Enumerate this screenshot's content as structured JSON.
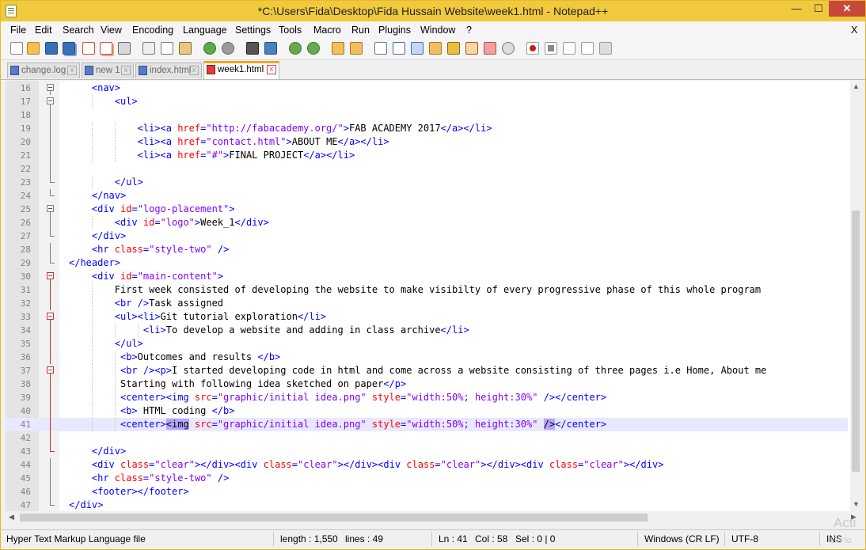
{
  "window": {
    "title": "*C:\\Users\\Fida\\Desktop\\Fida Hussain Website\\week1.html - Notepad++",
    "minimize": "—",
    "maximize": "☐",
    "close": "✕"
  },
  "menu": [
    "File",
    "Edit",
    "Search",
    "View",
    "Encoding",
    "Language",
    "Settings",
    "Tools",
    "Macro",
    "Run",
    "Plugins",
    "Window",
    "?"
  ],
  "menu_close": "X",
  "toolbar_icons": [
    "new-file-icon",
    "open-file-icon",
    "save-icon",
    "save-all-icon",
    "close-icon",
    "close-all-icon",
    "print-icon",
    "cut-icon",
    "copy-icon",
    "paste-icon",
    "undo-icon",
    "redo-icon",
    "find-icon",
    "replace-icon",
    "zoom-in-icon",
    "zoom-out-icon",
    "sync-vertical-icon",
    "sync-horizontal-icon",
    "word-wrap-icon",
    "show-all-chars-icon",
    "indent-guide-icon",
    "user-language-icon",
    "doc-map-icon",
    "function-list-icon",
    "folder-workspace-icon",
    "monitoring-icon",
    "record-macro-icon",
    "stop-record-icon",
    "play-macro-icon",
    "run-macro-multiple-icon",
    "save-macro-icon"
  ],
  "tabs": [
    {
      "label": "change.log",
      "active": false
    },
    {
      "label": "new 1",
      "active": false
    },
    {
      "label": "index.html",
      "active": false
    },
    {
      "label": "week1.html",
      "active": true
    }
  ],
  "tab_close": "x",
  "colors": {
    "tag": "#0000ff",
    "attr": "#ff0000",
    "string": "#8000ff",
    "titlebar": "#f0c93d",
    "highlight": "#b7a4ff"
  },
  "lines": [
    {
      "n": "16",
      "indent": 4,
      "fold": "box",
      "tokens": [
        [
          "tg",
          "<nav>"
        ]
      ]
    },
    {
      "n": "17",
      "indent": 8,
      "fold": "box",
      "tokens": [
        [
          "tg",
          "<ul>"
        ]
      ]
    },
    {
      "n": "18",
      "indent": 0,
      "fold": "line",
      "tokens": []
    },
    {
      "n": "19",
      "indent": 12,
      "fold": "line",
      "tokens": [
        [
          "tg",
          "<li><a "
        ],
        [
          "at",
          "href"
        ],
        [
          "tg",
          "="
        ],
        [
          "st",
          "\"http://fabacademy.org/\""
        ],
        [
          "tg",
          ">"
        ],
        [
          "tx",
          "FAB ACADEMY 2017"
        ],
        [
          "tg",
          "</a></li>"
        ]
      ]
    },
    {
      "n": "20",
      "indent": 12,
      "fold": "line",
      "tokens": [
        [
          "tg",
          "<li><a "
        ],
        [
          "at",
          "href"
        ],
        [
          "tg",
          "="
        ],
        [
          "st",
          "\"contact.html\""
        ],
        [
          "tg",
          ">"
        ],
        [
          "tx",
          "ABOUT ME"
        ],
        [
          "tg",
          "</a></li>"
        ]
      ]
    },
    {
      "n": "21",
      "indent": 12,
      "fold": "line",
      "tokens": [
        [
          "tg",
          "<li><a "
        ],
        [
          "at",
          "href"
        ],
        [
          "tg",
          "="
        ],
        [
          "st",
          "\"#\""
        ],
        [
          "tg",
          ">"
        ],
        [
          "tx",
          "FINAL PROJECT"
        ],
        [
          "tg",
          "</a></li>"
        ]
      ]
    },
    {
      "n": "22",
      "indent": 0,
      "fold": "line",
      "tokens": []
    },
    {
      "n": "23",
      "indent": 8,
      "fold": "end",
      "tokens": [
        [
          "tg",
          "</ul>"
        ]
      ]
    },
    {
      "n": "24",
      "indent": 4,
      "fold": "end",
      "tokens": [
        [
          "tg",
          "</nav>"
        ]
      ]
    },
    {
      "n": "25",
      "indent": 4,
      "fold": "box",
      "tokens": [
        [
          "tg",
          "<div "
        ],
        [
          "at",
          "id"
        ],
        [
          "tg",
          "="
        ],
        [
          "st",
          "\"logo-placement\""
        ],
        [
          "tg",
          ">"
        ]
      ]
    },
    {
      "n": "26",
      "indent": 8,
      "fold": "line",
      "tokens": [
        [
          "tg",
          "<div "
        ],
        [
          "at",
          "id"
        ],
        [
          "tg",
          "="
        ],
        [
          "st",
          "\"logo\""
        ],
        [
          "tg",
          ">"
        ],
        [
          "tx",
          "Week_1"
        ],
        [
          "tg",
          "</div>"
        ]
      ]
    },
    {
      "n": "27",
      "indent": 4,
      "fold": "end",
      "tokens": [
        [
          "tg",
          "</div>"
        ]
      ]
    },
    {
      "n": "28",
      "indent": 4,
      "fold": "line",
      "tokens": [
        [
          "tg",
          "<hr "
        ],
        [
          "at",
          "class"
        ],
        [
          "tg",
          "="
        ],
        [
          "st",
          "\"style-two\""
        ],
        [
          "tg",
          " />"
        ]
      ]
    },
    {
      "n": "29",
      "indent": 0,
      "fold": "end",
      "tokens": [
        [
          "tg",
          "</header>"
        ]
      ]
    },
    {
      "n": "30",
      "indent": 4,
      "fold": "boxred",
      "tokens": [
        [
          "tg",
          "<div "
        ],
        [
          "at",
          "id"
        ],
        [
          "tg",
          "="
        ],
        [
          "st",
          "\"main-content\""
        ],
        [
          "tg",
          ">"
        ]
      ]
    },
    {
      "n": "31",
      "indent": 8,
      "fold": "linered",
      "tokens": [
        [
          "tx",
          "First week consisted of developing the website to make visibilty of every progressive phase of this whole program"
        ]
      ]
    },
    {
      "n": "32",
      "indent": 8,
      "fold": "linered",
      "tokens": [
        [
          "tg",
          "<br />"
        ],
        [
          "tx",
          "Task assigned"
        ]
      ]
    },
    {
      "n": "33",
      "indent": 8,
      "fold": "boxred",
      "tokens": [
        [
          "tg",
          "<ul><li>"
        ],
        [
          "tx",
          "Git tutorial exploration"
        ],
        [
          "tg",
          "</li>"
        ]
      ]
    },
    {
      "n": "34",
      "indent": 13,
      "fold": "linered",
      "tokens": [
        [
          "tg",
          "<li>"
        ],
        [
          "tx",
          "To develop a website and adding in class archive"
        ],
        [
          "tg",
          "</li>"
        ]
      ]
    },
    {
      "n": "35",
      "indent": 8,
      "fold": "linered",
      "tokens": [
        [
          "tg",
          "</ul>"
        ]
      ]
    },
    {
      "n": "36",
      "indent": 9,
      "fold": "linered",
      "tokens": [
        [
          "tg",
          "<b>"
        ],
        [
          "tx",
          "Outcomes and results "
        ],
        [
          "tg",
          "</b>"
        ]
      ]
    },
    {
      "n": "37",
      "indent": 9,
      "fold": "boxred",
      "tokens": [
        [
          "tg",
          "<br /><p>"
        ],
        [
          "tx",
          "I started developing code in html and come across a website consisting of three pages i.e Home, About me"
        ]
      ]
    },
    {
      "n": "38",
      "indent": 9,
      "fold": "linered",
      "tokens": [
        [
          "tx",
          "Starting with following idea sketched on paper"
        ],
        [
          "tg",
          "</p>"
        ]
      ]
    },
    {
      "n": "39",
      "indent": 9,
      "fold": "linered",
      "tokens": [
        [
          "tg",
          "<center><img "
        ],
        [
          "at",
          "src"
        ],
        [
          "tg",
          "="
        ],
        [
          "st",
          "\"graphic/initial idea.png\""
        ],
        [
          "tg",
          " "
        ],
        [
          "at",
          "style"
        ],
        [
          "tg",
          "="
        ],
        [
          "st",
          "\"width:50%; height:30%\""
        ],
        [
          "tg",
          " /></center>"
        ]
      ]
    },
    {
      "n": "40",
      "indent": 9,
      "fold": "linered",
      "tokens": [
        [
          "tg",
          "<b>"
        ],
        [
          "tx",
          " HTML coding "
        ],
        [
          "tg",
          "</b>"
        ]
      ]
    },
    {
      "n": "41",
      "indent": 9,
      "fold": "linered",
      "current": true,
      "tokens": [
        [
          "tg",
          "<center>"
        ],
        [
          "hl",
          "<img"
        ],
        [
          "tg",
          " "
        ],
        [
          "at",
          "src"
        ],
        [
          "tg",
          "="
        ],
        [
          "st",
          "\"graphic/initial idea.png\""
        ],
        [
          "tg",
          " "
        ],
        [
          "at",
          "style"
        ],
        [
          "tg",
          "="
        ],
        [
          "st",
          "\"width:50%; height:30%\""
        ],
        [
          "tg",
          " "
        ],
        [
          "hl",
          "/>"
        ],
        [
          "tg",
          "</center>"
        ]
      ]
    },
    {
      "n": "42",
      "indent": 0,
      "fold": "linered",
      "tokens": []
    },
    {
      "n": "43",
      "indent": 4,
      "fold": "endred",
      "tokens": [
        [
          "tg",
          "</div>"
        ]
      ]
    },
    {
      "n": "44",
      "indent": 4,
      "fold": "line",
      "tokens": [
        [
          "tg",
          "<div "
        ],
        [
          "at",
          "class"
        ],
        [
          "tg",
          "="
        ],
        [
          "st",
          "\"clear\""
        ],
        [
          "tg",
          "></div><div "
        ],
        [
          "at",
          "class"
        ],
        [
          "tg",
          "="
        ],
        [
          "st",
          "\"clear\""
        ],
        [
          "tg",
          "></div><div "
        ],
        [
          "at",
          "class"
        ],
        [
          "tg",
          "="
        ],
        [
          "st",
          "\"clear\""
        ],
        [
          "tg",
          "></div><div "
        ],
        [
          "at",
          "class"
        ],
        [
          "tg",
          "="
        ],
        [
          "st",
          "\"clear\""
        ],
        [
          "tg",
          "></div>"
        ]
      ]
    },
    {
      "n": "45",
      "indent": 4,
      "fold": "line",
      "tokens": [
        [
          "tg",
          "<hr "
        ],
        [
          "at",
          "class"
        ],
        [
          "tg",
          "="
        ],
        [
          "st",
          "\"style-two\""
        ],
        [
          "tg",
          " />"
        ]
      ]
    },
    {
      "n": "46",
      "indent": 4,
      "fold": "line",
      "tokens": [
        [
          "tg",
          "<footer></footer>"
        ]
      ]
    },
    {
      "n": "47",
      "indent": 0,
      "fold": "end",
      "tokens": [
        [
          "tg",
          "</div>"
        ]
      ]
    }
  ],
  "status": {
    "filetype": "Hyper Text Markup Language file",
    "length": "length : 1,550",
    "lines": "lines : 49",
    "ln": "Ln : 41",
    "col": "Col : 58",
    "sel": "Sel : 0 | 0",
    "eol": "Windows (CR LF)",
    "encoding": "UTF-8",
    "mode": "INS"
  },
  "watermark": {
    "activate": "Acti",
    "goto": "Go to"
  }
}
